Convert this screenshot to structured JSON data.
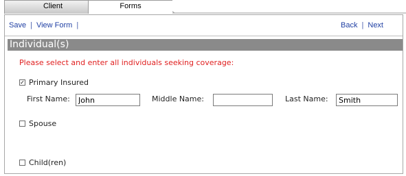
{
  "tabs": [
    {
      "label": "Client",
      "active": false
    },
    {
      "label": "Forms",
      "active": true
    }
  ],
  "toolbar": {
    "save": "Save",
    "view_form": "View Form",
    "back": "Back",
    "next": "Next",
    "separator": "|"
  },
  "section": {
    "title": "Individual(s)"
  },
  "instruction": "Please select and enter all individuals seeking coverage:",
  "primary": {
    "label": "Primary Insured",
    "checked": true,
    "first_name_label": "First Name:",
    "first_name_value": "John",
    "middle_name_label": "Middle Name:",
    "middle_name_value": "",
    "last_name_label": "Last Name:",
    "last_name_value": "Smith"
  },
  "spouse": {
    "label": "Spouse",
    "checked": false
  },
  "children": {
    "label": "Child(ren)",
    "checked": false
  },
  "colors": {
    "instruction_text": "#e02020",
    "section_header_bg": "#8a8a8a",
    "link": "#1f3fa3"
  }
}
